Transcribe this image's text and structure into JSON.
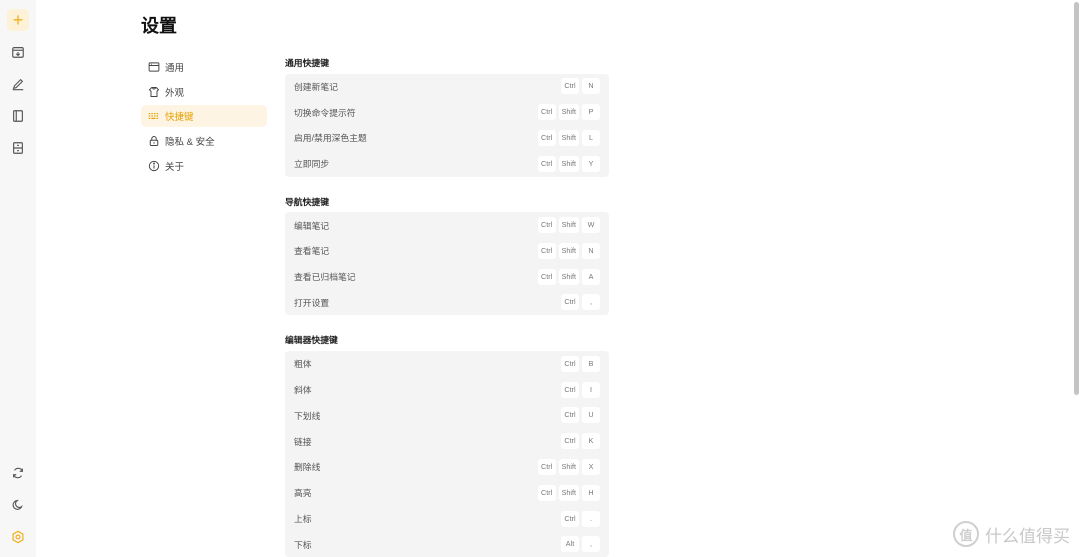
{
  "sidebar_rail": {
    "top_icons": [
      "add-note-icon",
      "import-icon",
      "edit-icon",
      "notebook-icon",
      "archive-icon"
    ],
    "bottom_icons": [
      "sync-icon",
      "theme-icon",
      "settings-icon"
    ],
    "accent": "#f2b01e"
  },
  "page": {
    "title": "设置"
  },
  "nav": {
    "items": [
      {
        "label": "通用",
        "icon": "window-icon"
      },
      {
        "label": "外观",
        "icon": "shirt-icon"
      },
      {
        "label": "快捷键",
        "icon": "keyboard-icon",
        "active": true
      },
      {
        "label": "隐私 & 安全",
        "icon": "lock-icon"
      },
      {
        "label": "关于",
        "icon": "info-icon"
      }
    ]
  },
  "sections": [
    {
      "title": "通用快捷键",
      "rows": [
        {
          "label": "创建新笔记",
          "keys": [
            "Ctrl",
            "N"
          ]
        },
        {
          "label": "切换命令提示符",
          "keys": [
            "Ctrl",
            "Shift",
            "P"
          ]
        },
        {
          "label": "启用/禁用深色主题",
          "keys": [
            "Ctrl",
            "Shift",
            "L"
          ]
        },
        {
          "label": "立即同步",
          "keys": [
            "Ctrl",
            "Shift",
            "Y"
          ]
        }
      ]
    },
    {
      "title": "导航快捷键",
      "rows": [
        {
          "label": "编辑笔记",
          "keys": [
            "Ctrl",
            "Shift",
            "W"
          ]
        },
        {
          "label": "查看笔记",
          "keys": [
            "Ctrl",
            "Shift",
            "N"
          ]
        },
        {
          "label": "查看已归档笔记",
          "keys": [
            "Ctrl",
            "Shift",
            "A"
          ]
        },
        {
          "label": "打开设置",
          "keys": [
            "Ctrl",
            ","
          ]
        }
      ]
    },
    {
      "title": "编辑器快捷键",
      "rows": [
        {
          "label": "粗体",
          "keys": [
            "Ctrl",
            "B"
          ]
        },
        {
          "label": "斜体",
          "keys": [
            "Ctrl",
            "I"
          ]
        },
        {
          "label": "下划线",
          "keys": [
            "Ctrl",
            "U"
          ]
        },
        {
          "label": "链接",
          "keys": [
            "Ctrl",
            "K"
          ]
        },
        {
          "label": "删除线",
          "keys": [
            "Ctrl",
            "Shift",
            "X"
          ]
        },
        {
          "label": "高亮",
          "keys": [
            "Ctrl",
            "Shift",
            "H"
          ]
        },
        {
          "label": "上标",
          "keys": [
            "Ctrl",
            "."
          ]
        },
        {
          "label": "下标",
          "keys": [
            "Alt",
            ","
          ]
        }
      ]
    }
  ],
  "watermark": {
    "text": "什么值得买",
    "logo_char": "值"
  }
}
